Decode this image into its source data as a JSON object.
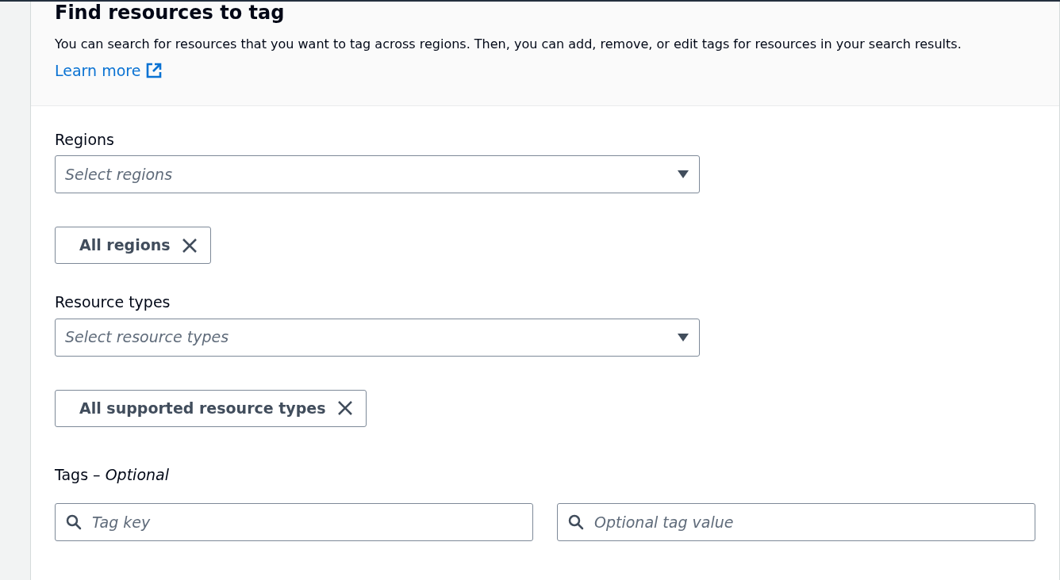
{
  "header": {
    "title": "Find resources to tag",
    "description": "You can search for resources that you want to tag across regions. Then, you can add, remove, or edit tags for resources in your search results.",
    "link": "Learn more"
  },
  "fields": [
    {
      "kind": "select",
      "label": "Regions",
      "placeholder": "Select regions",
      "tokens": [
        "All regions"
      ]
    },
    {
      "kind": "select",
      "label": "Resource types",
      "placeholder": "Select resource types",
      "tokens": [
        "All supported resource types"
      ]
    },
    {
      "kind": "search_pair",
      "label": "Tags – *Optional*",
      "inputs": [
        {
          "placeholder": "Tag key"
        },
        {
          "placeholder": "Optional tag value"
        }
      ]
    }
  ]
}
